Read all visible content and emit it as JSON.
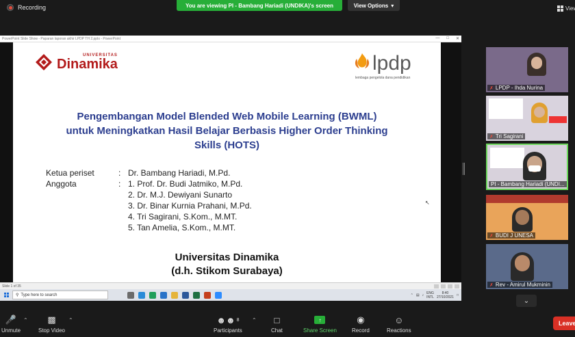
{
  "top": {
    "recording_label": "Recording",
    "viewing_banner": "You are viewing PI - Bambang Hariadi (UNDIKA)'s screen",
    "view_options": "View Options",
    "view_mode": "View"
  },
  "powerpoint": {
    "titlebar": "PowerPoint Slide Show - Paparan laporan akhir LPDP TH 2.pptx - PowerPoint",
    "status_slide": "Slide 1 of 35"
  },
  "slide": {
    "ud_small": "UNIVERSITAS",
    "ud_big": "Dinamika",
    "lpdp_text": "lpdp",
    "lpdp_sub": "lembaga pengelola dana pendidikan",
    "title_line1": "Pengembangan Model Blended Web Mobile Learning (BWML)",
    "title_line2": "untuk Meningkatkan Hasil Belajar Berbasis Higher Order Thinking",
    "title_line3": "Skills (HOTS)",
    "members": [
      {
        "label": "Ketua periset",
        "colon": ":",
        "value": "Dr. Bambang Hariadi, M.Pd."
      },
      {
        "label": "Anggota",
        "colon": ":",
        "value": "1. Prof. Dr. Budi Jatmiko, M.Pd."
      },
      {
        "label": "",
        "colon": "",
        "value": "2. Dr. M.J. Dewiyani Sunarto"
      },
      {
        "label": "",
        "colon": "",
        "value": "3. Dr. Binar Kurnia Prahani, M.Pd."
      },
      {
        "label": "",
        "colon": "",
        "value": "4. Tri Sagirani, S.Kom., M.MT."
      },
      {
        "label": "",
        "colon": "",
        "value": "5. Tan Amelia, S.Kom., M.MT."
      }
    ],
    "univ_line1": "Universitas  Dinamika",
    "univ_line2": "(d.h. Stikom Surabaya)"
  },
  "taskbar": {
    "search_placeholder": "Type here to search",
    "lang": "ENG",
    "lang2": "INTL",
    "time": "8:40",
    "date": "27/10/2021"
  },
  "participants": [
    {
      "name": "LPDP - Ihda Nurina",
      "muted": true,
      "active": false,
      "bg": "#7a6a8a"
    },
    {
      "name": "Tri Sagirani",
      "muted": true,
      "active": false,
      "bg": "#d9d3de"
    },
    {
      "name": "PI - Bambang Hariadi (UNDI...",
      "muted": false,
      "active": true,
      "bg": "#d8d2dc"
    },
    {
      "name": "BUDI J UNESA",
      "muted": true,
      "active": false,
      "bg": "#e28a3a"
    },
    {
      "name": "Rev - Amirul Mukminin",
      "muted": true,
      "active": false,
      "bg": "#6a7590"
    }
  ],
  "toolbar": {
    "unmute": "Unmute",
    "stop_video": "Stop Video",
    "participants": "Participants",
    "participants_count": "8",
    "chat": "Chat",
    "share_screen": "Share Screen",
    "record": "Record",
    "reactions": "Reactions",
    "leave": "Leave"
  },
  "colors": {
    "zoom_green": "#27ae38",
    "title_blue": "#2c3e8f",
    "dinamika_red": "#b31b1b",
    "leave_red": "#d93025"
  }
}
